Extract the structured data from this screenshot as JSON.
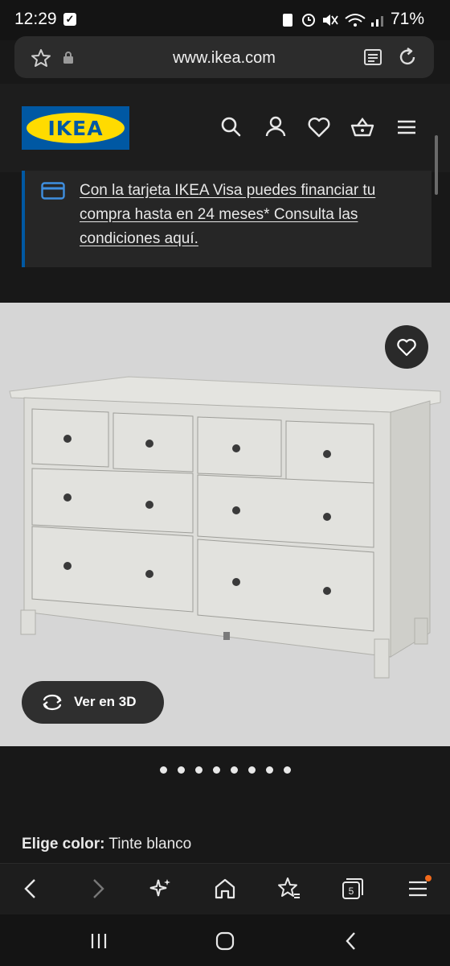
{
  "status_bar": {
    "time": "12:29",
    "battery": "71%"
  },
  "browser": {
    "url": "www.ikea.com",
    "tab_count": "5"
  },
  "header": {
    "logo_text": "IKEA"
  },
  "promo": {
    "text": "Con la tarjeta IKEA Visa puedes financiar tu compra hasta en 24 meses* Consulta las condiciones aquí."
  },
  "product": {
    "view_3d_label": "Ver en 3D",
    "image_count": 8,
    "active_image": 1
  },
  "color": {
    "label": "Elige color:",
    "value": "Tinte blanco"
  },
  "colors": {
    "ikea_blue": "#0058a3",
    "ikea_yellow": "#ffdb00",
    "background": "#181818",
    "product_bg": "#d6d6d6",
    "notification_dot": "#f26a1b"
  },
  "icons": {
    "header": [
      "search-icon",
      "user-icon",
      "heart-icon",
      "basket-icon",
      "menu-icon"
    ],
    "toolbar": [
      "back-icon",
      "forward-icon",
      "sparkle-icon",
      "home-icon",
      "bookmark-star-icon",
      "tabs-icon",
      "menu-icon"
    ],
    "navbar": [
      "recents-icon",
      "home-circle-icon",
      "back-icon"
    ]
  }
}
